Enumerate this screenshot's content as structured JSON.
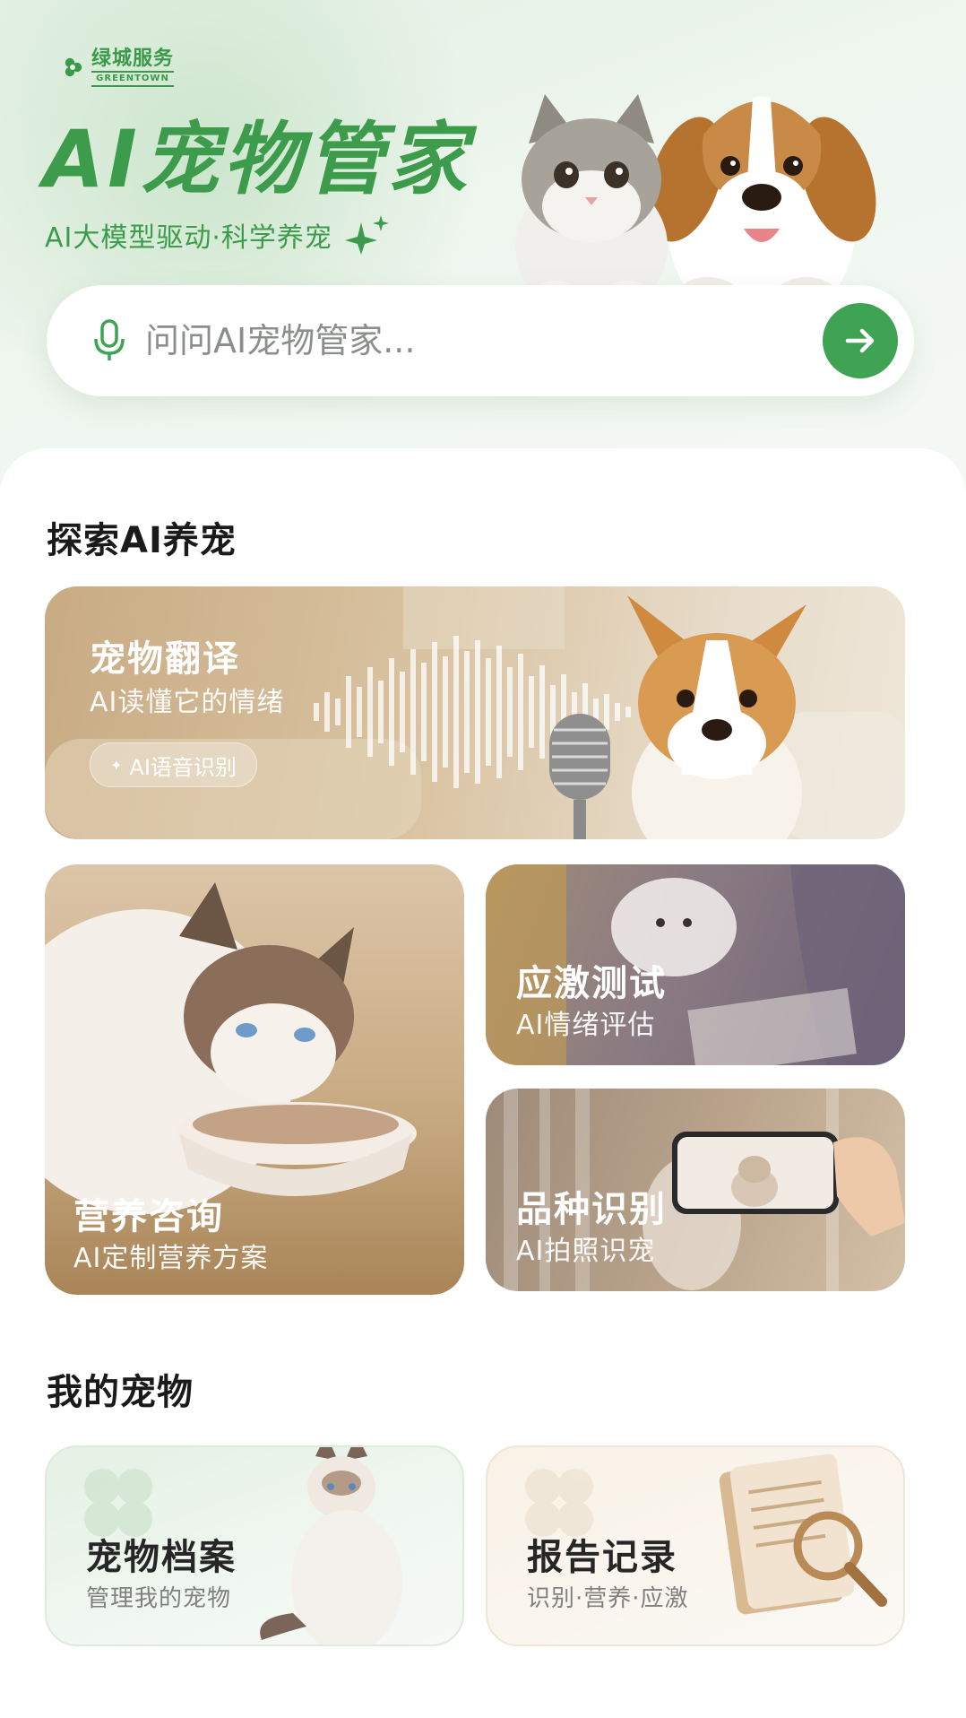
{
  "brand": {
    "name_cn": "绿城服务",
    "name_en": "GREENTOWN"
  },
  "hero": {
    "title": "AI宠物管家",
    "subtitle": "AI大模型驱动·科学养宠"
  },
  "search": {
    "placeholder": "问问AI宠物管家..."
  },
  "explore": {
    "title": "探索AI养宠",
    "translate": {
      "title": "宠物翻译",
      "subtitle": "AI读懂它的情绪",
      "chip": "AI语音识别"
    },
    "nutrition": {
      "title": "营养咨询",
      "subtitle": "AI定制营养方案"
    },
    "stress": {
      "title": "应激测试",
      "subtitle": "AI情绪评估"
    },
    "breed": {
      "title": "品种识别",
      "subtitle": "AI拍照识宠"
    }
  },
  "mine": {
    "title": "我的宠物",
    "profile": {
      "title": "宠物档案",
      "subtitle": "管理我的宠物"
    },
    "reports": {
      "title": "报告记录",
      "subtitle": "识别·营养·应激"
    }
  },
  "colors": {
    "brand_green": "#3c9c4c",
    "action_green": "#3ea453"
  },
  "icons": [
    "greentown-logo-icon",
    "sparkle-icon",
    "microphone-icon",
    "arrow-right-icon",
    "clover-icon",
    "magnifier-icon",
    "star-icon"
  ]
}
